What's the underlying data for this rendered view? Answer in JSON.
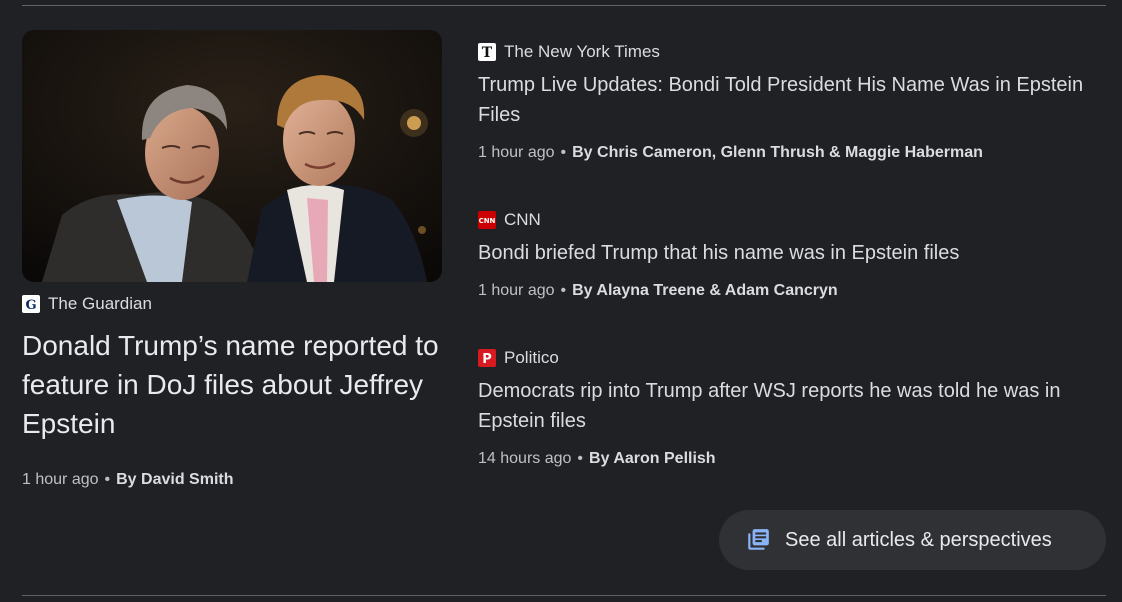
{
  "hero": {
    "image_alt": "Jeffrey Epstein and Donald Trump",
    "source": "The Guardian",
    "source_logo_text": "G",
    "title": "Donald Trump’s name reported to feature in DoJ files about Jeffrey Epstein",
    "time": "1 hour ago",
    "separator": "•",
    "byline": "By David Smith"
  },
  "articles": [
    {
      "source": "The New York Times",
      "source_logo_text": "T",
      "headline": "Trump Live Updates: Bondi Told President His Name Was in Epstein Files",
      "time": "1 hour ago",
      "separator": "•",
      "byline": "By Chris Cameron, Glenn Thrush & Maggie Haberman"
    },
    {
      "source": "CNN",
      "source_logo_text": "CNN",
      "headline": "Bondi briefed Trump that his name was in Epstein files",
      "time": "1 hour ago",
      "separator": "•",
      "byline": "By Alayna Treene & Adam Cancryn"
    },
    {
      "source": "Politico",
      "source_logo_text": "P",
      "headline": "Democrats rip into Trump after WSJ reports he was told he was in Epstein files",
      "time": "14 hours ago",
      "separator": "•",
      "byline": "By Aaron Pellish"
    }
  ],
  "see_all": {
    "label": "See all articles & perspectives",
    "icon": "articles-icon"
  },
  "colors": {
    "background": "#202124",
    "accent_blue": "#8ab4f8",
    "cnn_red": "#cc0000",
    "politico_red": "#d71920"
  }
}
